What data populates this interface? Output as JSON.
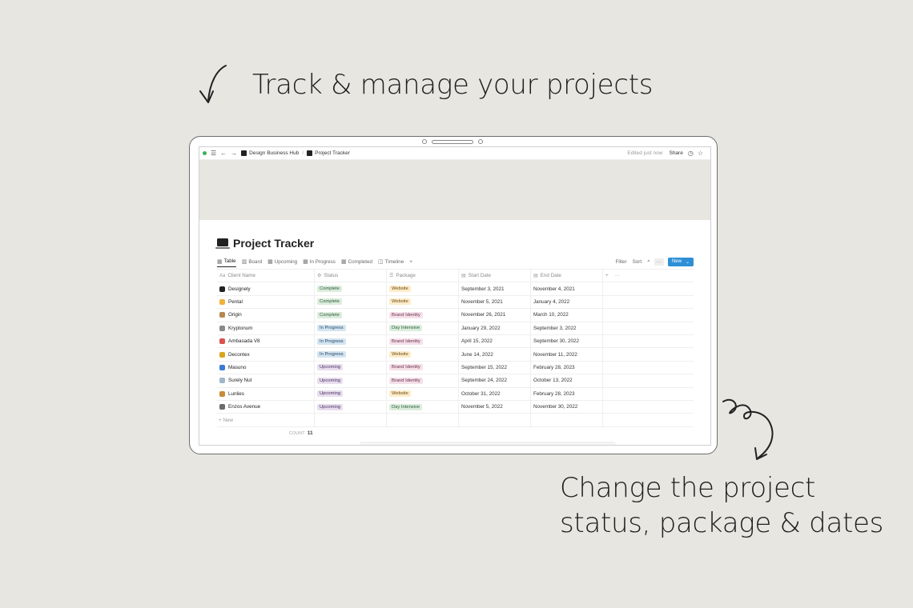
{
  "headline": "Track & manage your projects",
  "caption": [
    "Change the project",
    "status, package & dates"
  ],
  "topbar": {
    "nav_back": "←",
    "nav_forward": "→",
    "menu": "☰",
    "breadcrumb_workspace": "Design Business Hub",
    "breadcrumb_page": "Project Tracker",
    "edited": "Edited just now",
    "share": "Share"
  },
  "page_title": "Project Tracker",
  "views": [
    {
      "label": "Table",
      "icon": "table-icon"
    },
    {
      "label": "Board",
      "icon": "board-icon"
    },
    {
      "label": "Upcoming",
      "icon": "table-icon"
    },
    {
      "label": "In Progress",
      "icon": "table-icon"
    },
    {
      "label": "Completed",
      "icon": "table-icon"
    },
    {
      "label": "Timeline",
      "icon": "timeline-icon"
    }
  ],
  "toolbar": {
    "add_view": "+",
    "filter": "Filter",
    "sort": "Sort",
    "more": "···",
    "new": "New"
  },
  "columns": [
    "Client Name",
    "Status",
    "Package",
    "Start Date",
    "End Date"
  ],
  "column_extra": {
    "add": "+",
    "more": "···"
  },
  "status_colors": {
    "Complete": {
      "bg": "#dbeddb",
      "fg": "#2b593f"
    },
    "In Progress": {
      "bg": "#d3e5ef",
      "fg": "#28456c"
    },
    "Upcoming": {
      "bg": "#e8deee",
      "fg": "#492f64"
    }
  },
  "package_colors": {
    "Website": {
      "bg": "#fdecc8",
      "fg": "#6b4a16"
    },
    "Brand Identity": {
      "bg": "#f5e0e9",
      "fg": "#69314c"
    },
    "Day Intensive": {
      "bg": "#dbeddb",
      "fg": "#2b593f"
    }
  },
  "rows": [
    {
      "client": "Designely",
      "icon_color": "#222222",
      "status": "Complete",
      "package": "Website",
      "start": "September 3, 2021",
      "end": "November 4, 2021"
    },
    {
      "client": "Pental",
      "icon_color": "#f2b13b",
      "status": "Complete",
      "package": "Website",
      "start": "November 5, 2021",
      "end": "January 4, 2022"
    },
    {
      "client": "Origin",
      "icon_color": "#b5874d",
      "status": "Complete",
      "package": "Brand Identity",
      "start": "November 26, 2021",
      "end": "March 10, 2022"
    },
    {
      "client": "Kryptonum",
      "icon_color": "#8a8a8a",
      "status": "In Progress",
      "package": "Day Intensive",
      "start": "January 29, 2022",
      "end": "September 3, 2022"
    },
    {
      "client": "Ambasada V8",
      "icon_color": "#d9534f",
      "status": "In Progress",
      "package": "Brand Identity",
      "start": "April 15, 2022",
      "end": "September 30, 2022"
    },
    {
      "client": "Decontex",
      "icon_color": "#d9a520",
      "status": "In Progress",
      "package": "Website",
      "start": "June 14, 2022",
      "end": "November 11, 2022"
    },
    {
      "client": "Masuno",
      "icon_color": "#3a7bd5",
      "status": "Upcoming",
      "package": "Brand Identity",
      "start": "September 15, 2022",
      "end": "February 28, 2023"
    },
    {
      "client": "Surely Nut",
      "icon_color": "#9fb6c9",
      "status": "Upcoming",
      "package": "Brand Identity",
      "start": "September 24, 2022",
      "end": "October 13, 2022"
    },
    {
      "client": "Lunlies",
      "icon_color": "#c98a3a",
      "status": "Upcoming",
      "package": "Website",
      "start": "October 31, 2022",
      "end": "February 28, 2023"
    },
    {
      "client": "Enzos Avenue",
      "icon_color": "#6b6b6b",
      "status": "Upcoming",
      "package": "Day Intensive",
      "start": "November 5, 2022",
      "end": "November 30, 2022"
    }
  ],
  "new_row": "+ New",
  "count_label": "COUNT",
  "count_value": "11"
}
